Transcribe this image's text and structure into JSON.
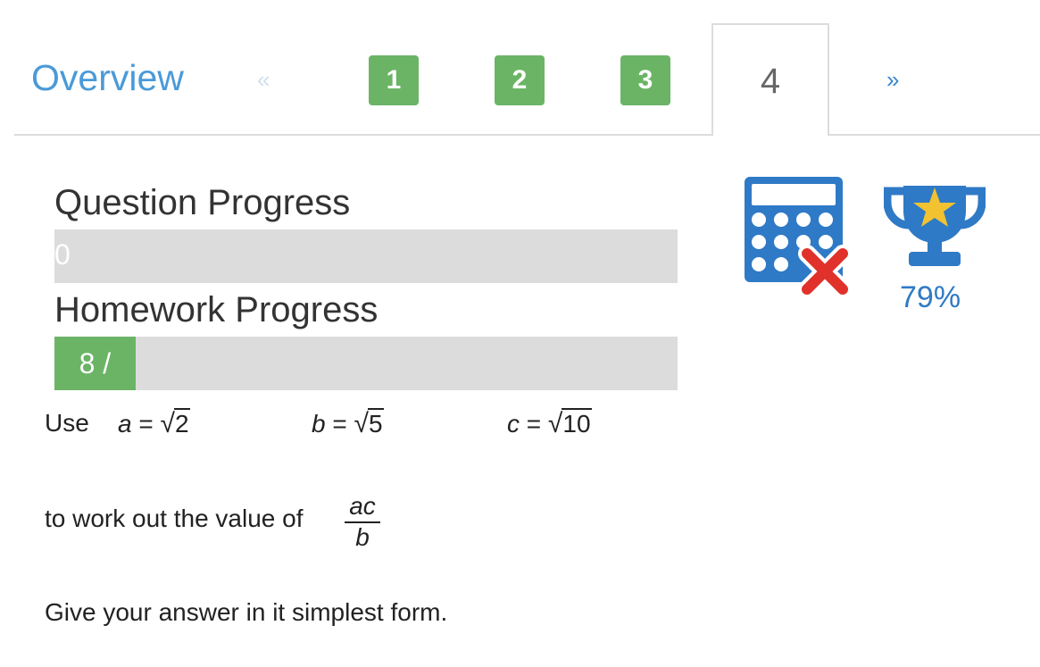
{
  "nav": {
    "overview_label": "Overview",
    "prev_label": "«",
    "next_label": "»",
    "questions": [
      "1",
      "2",
      "3"
    ],
    "active_label": "4"
  },
  "question_progress": {
    "label": "Question Progress",
    "value_text": "0",
    "fraction": 0
  },
  "homework_progress": {
    "label": "Homework Progress",
    "value_text": "8 /",
    "fraction": 0.13
  },
  "stats": {
    "calculator_icon": "calculator-not-allowed-icon",
    "trophy_icon": "trophy-icon",
    "score": "79%"
  },
  "question": {
    "use_label": "Use",
    "a_var": "a",
    "a_eq": " = ",
    "a_rad": "2",
    "b_var": "b",
    "b_eq": " = ",
    "b_rad": "5",
    "c_var": "c",
    "c_eq": " = ",
    "c_rad": "10",
    "prompt": "to work out the value of",
    "frac_num": "ac",
    "frac_den": "b",
    "instruction": "Give your answer in it simplest form."
  },
  "colors": {
    "accent": "#4a9ad8",
    "success": "#6bb466",
    "bar_bg": "#dcdcdc",
    "icon_blue": "#2f7ac6",
    "cross_red": "#e0322a",
    "star_yellow": "#f2c231"
  }
}
